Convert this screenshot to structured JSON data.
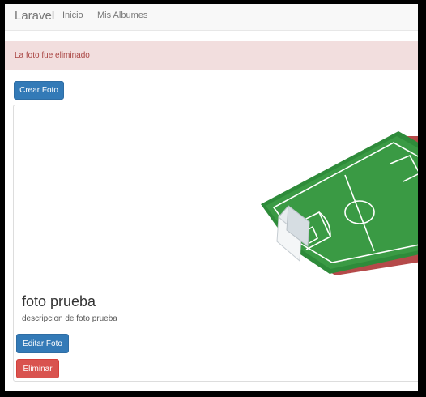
{
  "navbar": {
    "brand": "Laravel",
    "links": [
      {
        "label": "Inicio"
      },
      {
        "label": "Mis Albumes"
      }
    ]
  },
  "alert": {
    "message": "La foto fue eliminado",
    "color": "#a94442",
    "background": "#f2dede"
  },
  "actions": {
    "create_label": "Crear Foto"
  },
  "photo_card": {
    "title": "foto prueba",
    "description": "descripcion de foto prueba",
    "image_icon": "soccer-field-image",
    "edit_label": "Editar Foto",
    "delete_label": "Eliminar"
  },
  "colors": {
    "primary": "#337ab7",
    "danger": "#d9534f"
  }
}
